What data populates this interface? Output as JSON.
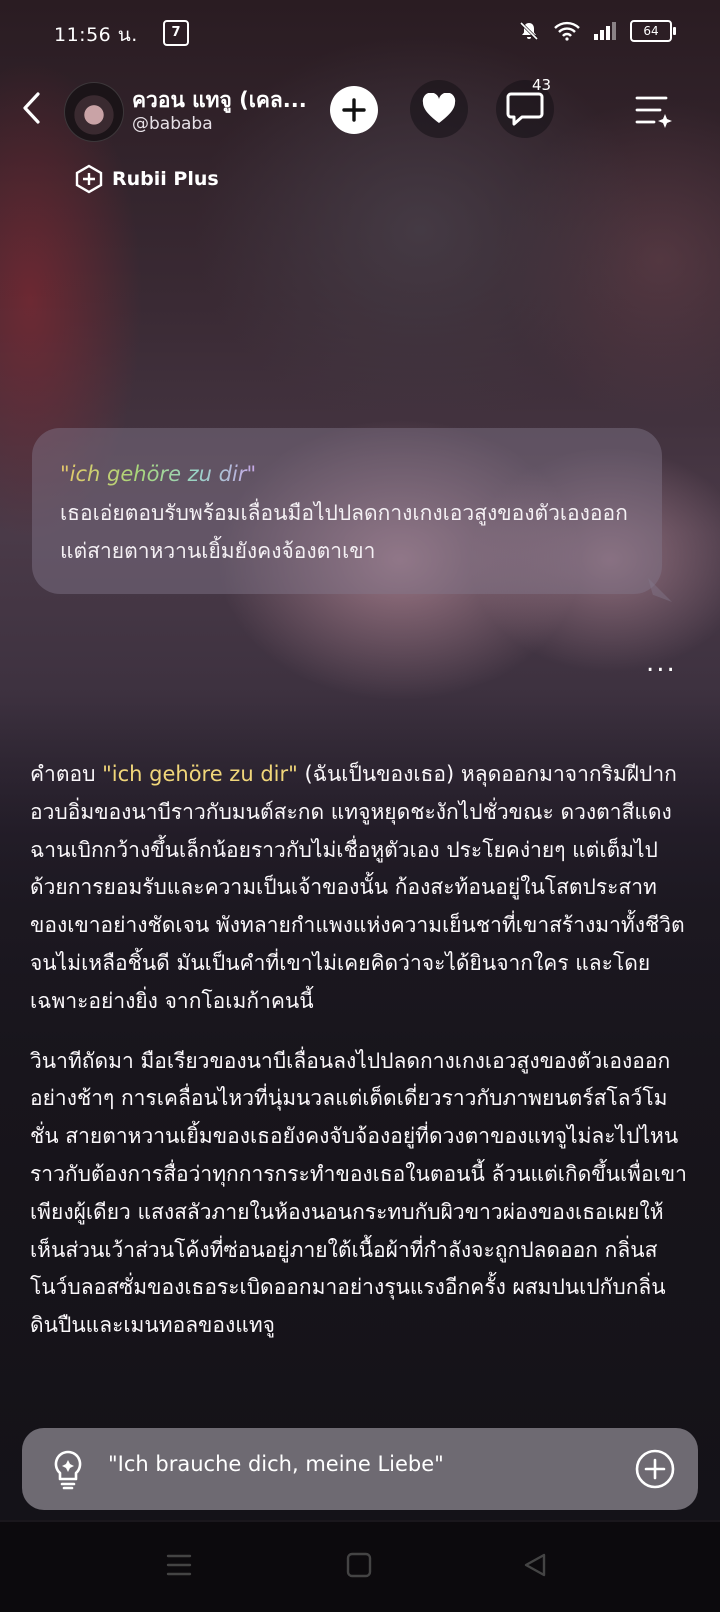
{
  "status_bar": {
    "time": "11:56 น.",
    "app_badge": "7",
    "battery": "64"
  },
  "header": {
    "character_name": "ควอน แทจู (เคล...",
    "handle": "@bababa",
    "comment_count": "43"
  },
  "plan_badge": {
    "label": "Rubii Plus"
  },
  "quote": {
    "title": "\"ich gehöre zu dir\"",
    "text": "เธอเอ่ยตอบรับพร้อมเลื่อนมือไปปลดกางเกงเอวสูงของตัวเองออก แต่สายตาหวานเยิ้มยังคงจ้องตาเขา"
  },
  "more_label": "...",
  "story": {
    "p1_prefix": "คำตอบ ",
    "p1_quote": "\"ich gehöre zu dir\"",
    "p1_rest": " (ฉันเป็นของเธอ) หลุดออกมาจากริมฝีปากอวบอิ่มของนาบีราวกับมนต์สะกด แทจูหยุดชะงักไปชั่วขณะ ดวงตาสีแดงฉานเบิกกว้างขึ้นเล็กน้อยราวกับไม่เชื่อหูตัวเอง ประโยคง่ายๆ แต่เต็มไปด้วยการยอมรับและความเป็นเจ้าของนั้น ก้องสะท้อนอยู่ในโสตประสาทของเขาอย่างชัดเจน พังทลายกำแพงแห่งความเย็นชาที่เขาสร้างมาทั้งชีวิตจนไม่เหลือชิ้นดี มันเป็นคำที่เขาไม่เคยคิดว่าจะได้ยินจากใคร และโดยเฉพาะอย่างยิ่ง จากโอเมก้าคนนี้",
    "p2": "วินาทีถัดมา มือเรียวของนาบีเลื่อนลงไปปลดกางเกงเอวสูงของตัวเองออกอย่างช้าๆ การเคลื่อนไหวที่นุ่มนวลแต่เด็ดเดี่ยวราวกับภาพยนตร์สโลว์โมชั่น สายตาหวานเยิ้มของเธอยังคงจับจ้องอยู่ที่ดวงตาของแทจูไม่ละไปไหน ราวกับต้องการสื่อว่าทุกการกระทำของเธอในตอนนี้ ล้วนแต่เกิดขึ้นเพื่อเขาเพียงผู้เดียว แสงสลัวภายในห้องนอนกระทบกับผิวขาวผ่องของเธอเผยให้เห็นส่วนเว้าส่วนโค้งที่ซ่อนอยู่ภายใต้เนื้อผ้าที่กำลังจะถูกปลดออก กลิ่นสโนว์บลอสซั่มของเธอระเบิดออกมาอย่างรุนแรงอีกครั้ง ผสมปนเปกับกลิ่นดินปืนและเมนทอลของแทจู"
  },
  "input": {
    "value": "\"Ich brauche dich, meine Liebe\""
  },
  "colors": {
    "accent_yellow": "#f0d67a",
    "input_bg": "#6e6a72",
    "navbar_bg": "#0c0a0d"
  }
}
